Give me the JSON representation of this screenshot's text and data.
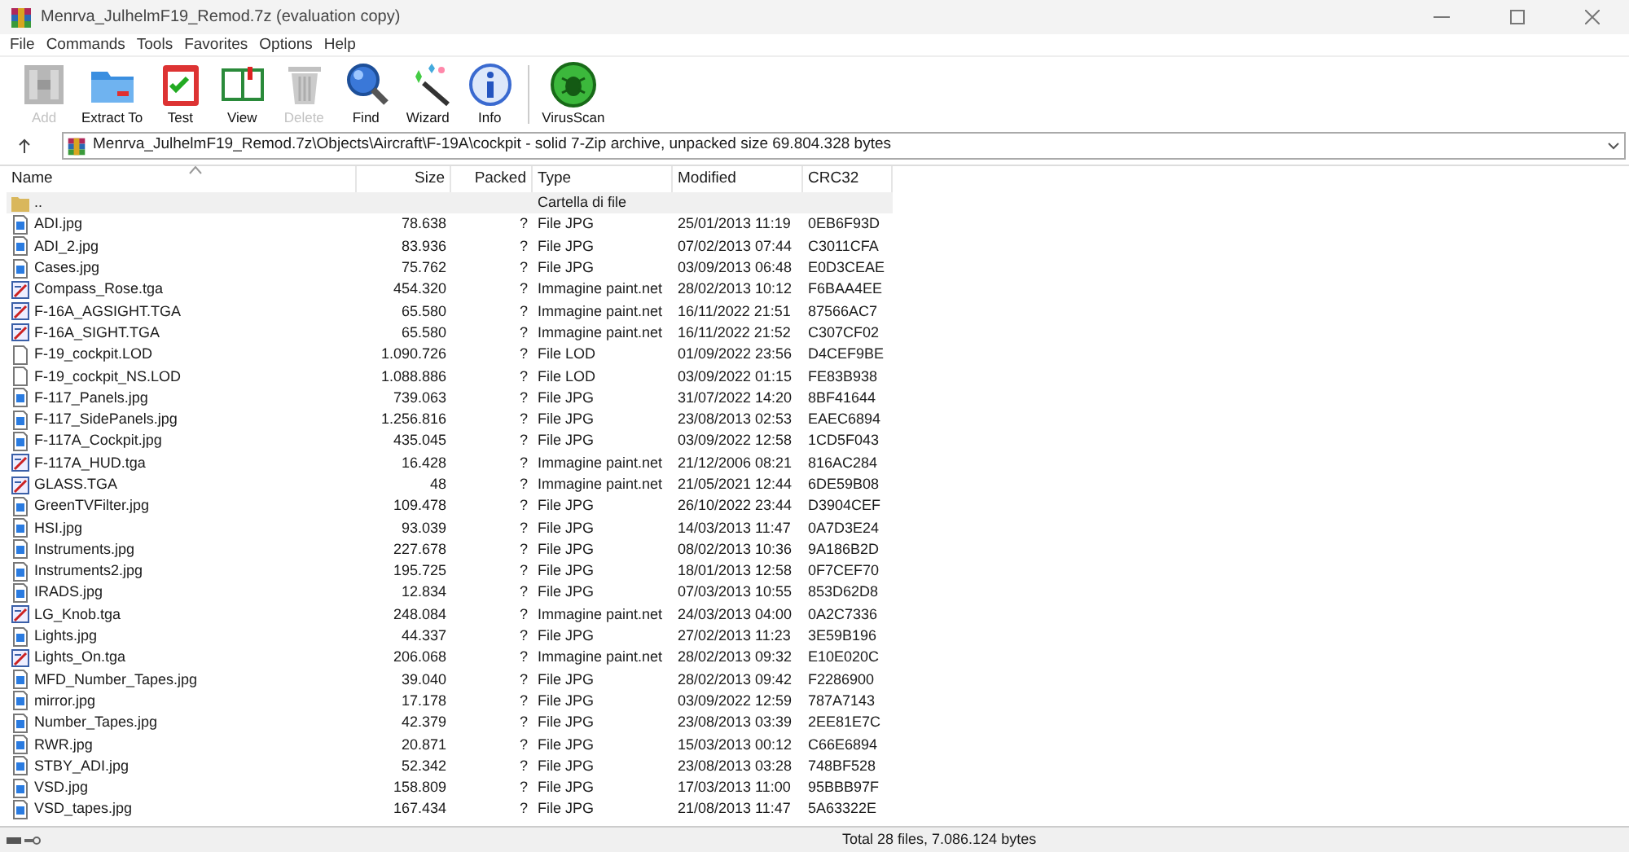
{
  "window": {
    "title": "Menrva_JulhelmF19_Remod.7z (evaluation copy)"
  },
  "menu": [
    "File",
    "Commands",
    "Tools",
    "Favorites",
    "Options",
    "Help"
  ],
  "toolbar": [
    {
      "kind": "add",
      "label": "Add",
      "disabled": true
    },
    {
      "kind": "extract",
      "label": "Extract To",
      "disabled": false
    },
    {
      "kind": "test",
      "label": "Test",
      "disabled": false
    },
    {
      "kind": "view",
      "label": "View",
      "disabled": false
    },
    {
      "kind": "delete",
      "label": "Delete",
      "disabled": true
    },
    {
      "kind": "find",
      "label": "Find",
      "disabled": false
    },
    {
      "kind": "wizard",
      "label": "Wizard",
      "disabled": false
    },
    {
      "kind": "info",
      "label": "Info",
      "disabled": false
    },
    {
      "kind": "virus",
      "label": "VirusScan",
      "disabled": false
    }
  ],
  "address": "Menrva_JulhelmF19_Remod.7z\\Objects\\Aircraft\\F-19A\\cockpit - solid 7-Zip archive, unpacked size 69.804.328 bytes",
  "table": {
    "columns": [
      "Name",
      "Size",
      "Packed",
      "Type",
      "Modified",
      "CRC32"
    ],
    "rows": [
      {
        "kind": "folder",
        "selected": true,
        "cells": [
          "..",
          "",
          "",
          "Cartella di file",
          "",
          ""
        ]
      },
      {
        "kind": "jpg",
        "selected": false,
        "cells": [
          "ADI.jpg",
          "78.638",
          "?",
          "File JPG",
          "25/01/2013 11:19",
          "0EB6F93D"
        ]
      },
      {
        "kind": "jpg",
        "selected": false,
        "cells": [
          "ADI_2.jpg",
          "83.936",
          "?",
          "File JPG",
          "07/02/2013 07:44",
          "C3011CFA"
        ]
      },
      {
        "kind": "jpg",
        "selected": false,
        "cells": [
          "Cases.jpg",
          "75.762",
          "?",
          "File JPG",
          "03/09/2013 06:48",
          "E0D3CEAE"
        ]
      },
      {
        "kind": "tga",
        "selected": false,
        "cells": [
          "Compass_Rose.tga",
          "454.320",
          "?",
          "Immagine paint.net",
          "28/02/2013 10:12",
          "F6BAA4EE"
        ]
      },
      {
        "kind": "tga",
        "selected": false,
        "cells": [
          "F-16A_AGSIGHT.TGA",
          "65.580",
          "?",
          "Immagine paint.net",
          "16/11/2022 21:51",
          "87566AC7"
        ]
      },
      {
        "kind": "tga",
        "selected": false,
        "cells": [
          "F-16A_SIGHT.TGA",
          "65.580",
          "?",
          "Immagine paint.net",
          "16/11/2022 21:52",
          "C307CF02"
        ]
      },
      {
        "kind": "file",
        "selected": false,
        "cells": [
          "F-19_cockpit.LOD",
          "1.090.726",
          "?",
          "File LOD",
          "01/09/2022 23:56",
          "D4CEF9BE"
        ]
      },
      {
        "kind": "file",
        "selected": false,
        "cells": [
          "F-19_cockpit_NS.LOD",
          "1.088.886",
          "?",
          "File LOD",
          "03/09/2022 01:15",
          "FE83B938"
        ]
      },
      {
        "kind": "jpg",
        "selected": false,
        "cells": [
          "F-117_Panels.jpg",
          "739.063",
          "?",
          "File JPG",
          "31/07/2022 14:20",
          "8BF41644"
        ]
      },
      {
        "kind": "jpg",
        "selected": false,
        "cells": [
          "F-117_SidePanels.jpg",
          "1.256.816",
          "?",
          "File JPG",
          "23/08/2013 02:53",
          "EAEC6894"
        ]
      },
      {
        "kind": "jpg",
        "selected": false,
        "cells": [
          "F-117A_Cockpit.jpg",
          "435.045",
          "?",
          "File JPG",
          "03/09/2022 12:58",
          "1CD5F043"
        ]
      },
      {
        "kind": "tga",
        "selected": false,
        "cells": [
          "F-117A_HUD.tga",
          "16.428",
          "?",
          "Immagine paint.net",
          "21/12/2006 08:21",
          "816AC284"
        ]
      },
      {
        "kind": "tga",
        "selected": false,
        "cells": [
          "GLASS.TGA",
          "48",
          "?",
          "Immagine paint.net",
          "21/05/2021 12:44",
          "6DE59B08"
        ]
      },
      {
        "kind": "jpg",
        "selected": false,
        "cells": [
          "GreenTVFilter.jpg",
          "109.478",
          "?",
          "File JPG",
          "26/10/2022 23:44",
          "D3904CEF"
        ]
      },
      {
        "kind": "jpg",
        "selected": false,
        "cells": [
          "HSI.jpg",
          "93.039",
          "?",
          "File JPG",
          "14/03/2013 11:47",
          "0A7D3E24"
        ]
      },
      {
        "kind": "jpg",
        "selected": false,
        "cells": [
          "Instruments.jpg",
          "227.678",
          "?",
          "File JPG",
          "08/02/2013 10:36",
          "9A186B2D"
        ]
      },
      {
        "kind": "jpg",
        "selected": false,
        "cells": [
          "Instruments2.jpg",
          "195.725",
          "?",
          "File JPG",
          "18/01/2013 12:58",
          "0F7CEF70"
        ]
      },
      {
        "kind": "jpg",
        "selected": false,
        "cells": [
          "IRADS.jpg",
          "12.834",
          "?",
          "File JPG",
          "07/03/2013 10:55",
          "853D62D8"
        ]
      },
      {
        "kind": "tga",
        "selected": false,
        "cells": [
          "LG_Knob.tga",
          "248.084",
          "?",
          "Immagine paint.net",
          "24/03/2013 04:00",
          "0A2C7336"
        ]
      },
      {
        "kind": "jpg",
        "selected": false,
        "cells": [
          "Lights.jpg",
          "44.337",
          "?",
          "File JPG",
          "27/02/2013 11:23",
          "3E59B196"
        ]
      },
      {
        "kind": "tga",
        "selected": false,
        "cells": [
          "Lights_On.tga",
          "206.068",
          "?",
          "Immagine paint.net",
          "28/02/2013 09:32",
          "E10E020C"
        ]
      },
      {
        "kind": "jpg",
        "selected": false,
        "cells": [
          "MFD_Number_Tapes.jpg",
          "39.040",
          "?",
          "File JPG",
          "28/02/2013 09:42",
          "F2286900"
        ]
      },
      {
        "kind": "jpg",
        "selected": false,
        "cells": [
          "mirror.jpg",
          "17.178",
          "?",
          "File JPG",
          "03/09/2022 12:59",
          "787A7143"
        ]
      },
      {
        "kind": "jpg",
        "selected": false,
        "cells": [
          "Number_Tapes.jpg",
          "42.379",
          "?",
          "File JPG",
          "23/08/2013 03:39",
          "2EE81E7C"
        ]
      },
      {
        "kind": "jpg",
        "selected": false,
        "cells": [
          "RWR.jpg",
          "20.871",
          "?",
          "File JPG",
          "15/03/2013 00:12",
          "C66E6894"
        ]
      },
      {
        "kind": "jpg",
        "selected": false,
        "cells": [
          "STBY_ADI.jpg",
          "52.342",
          "?",
          "File JPG",
          "23/08/2013 03:28",
          "748BF528"
        ]
      },
      {
        "kind": "jpg",
        "selected": false,
        "cells": [
          "VSD.jpg",
          "158.809",
          "?",
          "File JPG",
          "17/03/2013 11:00",
          "95BBB97F"
        ]
      },
      {
        "kind": "jpg",
        "selected": false,
        "cells": [
          "VSD_tapes.jpg",
          "167.434",
          "?",
          "File JPG",
          "21/08/2013 11:47",
          "5A63322E"
        ]
      }
    ]
  },
  "status_bar": "Total 28 files, 7.086.124 bytes"
}
